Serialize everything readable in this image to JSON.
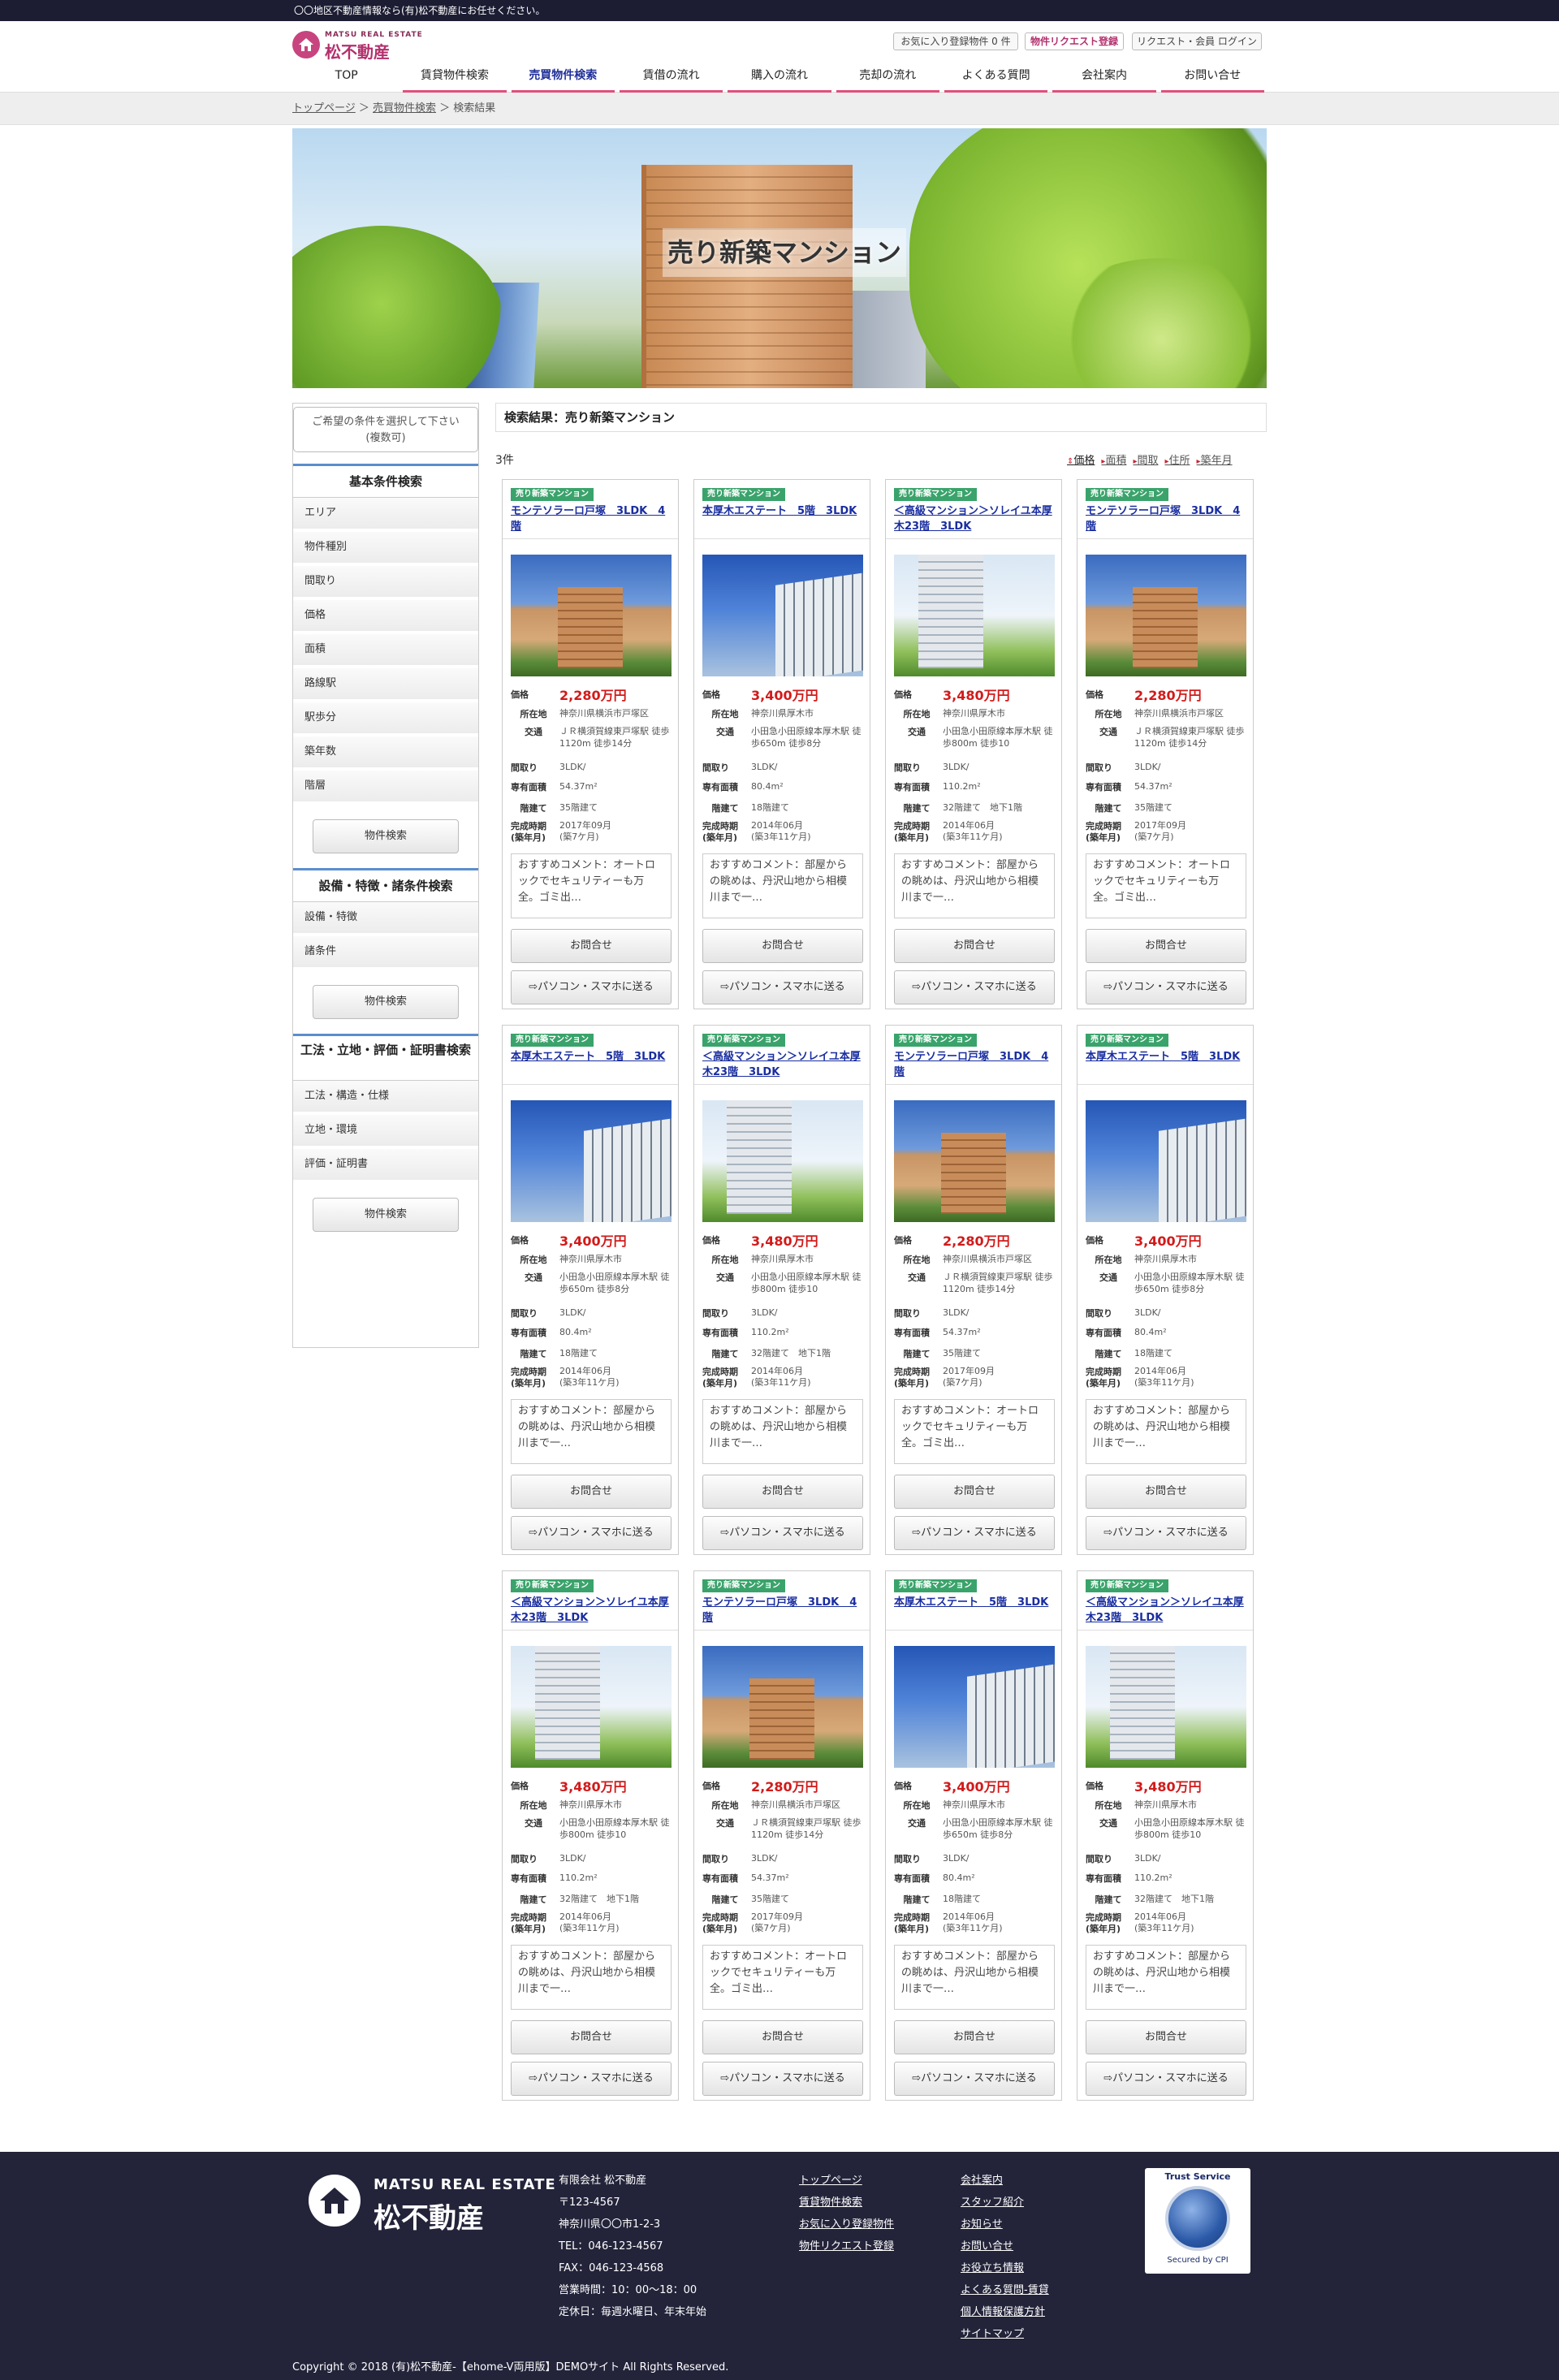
{
  "topbar": {
    "text": "〇〇地区不動産情報なら(有)松不動産にお任せください。"
  },
  "header": {
    "brand_en": "MATSU REAL ESTATE",
    "brand_jp": "松不動産",
    "favorite_text": "お気に入り登録物件 0 件",
    "request_label": "物件リクエスト登録",
    "login_label": "リクエスト・会員 ログイン",
    "accent_color": "#e04f7b"
  },
  "nav": [
    {
      "label": "TOP",
      "underline": false,
      "active": false
    },
    {
      "label": "賃貸物件検索",
      "underline": true,
      "active": false
    },
    {
      "label": "売買物件検索",
      "underline": true,
      "active": true
    },
    {
      "label": "賃借の流れ",
      "underline": true,
      "active": false
    },
    {
      "label": "購入の流れ",
      "underline": true,
      "active": false
    },
    {
      "label": "売却の流れ",
      "underline": true,
      "active": false
    },
    {
      "label": "よくある質問",
      "underline": true,
      "active": false
    },
    {
      "label": "会社案内",
      "underline": true,
      "active": false
    },
    {
      "label": "お問い合せ",
      "underline": true,
      "active": false
    }
  ],
  "breadcrumb": {
    "top": "トップページ",
    "sep": " ＞ ",
    "sale": "売買物件検索",
    "current": "検索結果"
  },
  "hero": {
    "title": "売り新築マンション"
  },
  "sidebar": {
    "note": "ご希望の条件を選択して下さい\n(複数可)",
    "sections": [
      {
        "title": "基本条件検索",
        "items": [
          "エリア",
          "物件種別",
          "間取り",
          "価格",
          "面積",
          "路線駅",
          "駅歩分",
          "築年数",
          "階層"
        ],
        "button": "物件検索"
      },
      {
        "title": "設備・特徴・諸条件検索",
        "items": [
          "設備・特徴",
          "諸条件"
        ],
        "button": "物件検索"
      },
      {
        "title": "工法・立地・評価・証明書検索",
        "items": [
          "工法・構造・仕様",
          "立地・環境",
          "評価・証明書"
        ],
        "button": "物件検索"
      }
    ]
  },
  "results": {
    "heading": "検索結果：売り新築マンション",
    "count": "3件",
    "sort": [
      "価格",
      "面積",
      "間取",
      "住所",
      "築年月"
    ],
    "labels": {
      "price": "価格",
      "address": "所在地",
      "access": "交通",
      "layout": "間取り",
      "area": "専有面積",
      "floors": "階建て",
      "built": "完成時期",
      "built_sub": "(築年月)",
      "contact": "お問合せ",
      "send": "⇨パソコン・スマホに送る"
    }
  },
  "properties": {
    "a": {
      "tag": "売り新築マンション",
      "title": "モンテソラーロ戸塚　3LDK　4階",
      "price": "2,280万円",
      "address": "神奈川県横浜市戸塚区",
      "access": "ＪＲ横須賀線東戸塚駅 徒歩1120m 徒歩14分",
      "layout": "3LDK/",
      "area": "54.37m²",
      "floors": "35階建て",
      "built": "2017年09月",
      "built_sub": "(築7ケ月)",
      "comment": "おすすめコメント：オートロックでセキュリティーも万全。ゴミ出…",
      "photo": "p1"
    },
    "b": {
      "tag": "売り新築マンション",
      "title": "本厚木エステート　5階　3LDK",
      "price": "3,400万円",
      "address": "神奈川県厚木市",
      "access": "小田急小田原線本厚木駅 徒歩650m 徒歩8分",
      "layout": "3LDK/",
      "area": "80.4m²",
      "floors": "18階建て",
      "built": "2014年06月",
      "built_sub": "(築3年11ケ月)",
      "comment": "おすすめコメント：部屋からの眺めは、丹沢山地から相模川まで一…",
      "photo": "p2"
    },
    "c": {
      "tag": "売り新築マンション",
      "title": "＜高級マンション＞ソレイユ本厚木23階　3LDK",
      "price": "3,480万円",
      "address": "神奈川県厚木市",
      "access": "小田急小田原線本厚木駅 徒歩800m 徒歩10",
      "layout": "3LDK/",
      "area": "110.2m²",
      "floors": "32階建て　地下1階",
      "built": "2014年06月",
      "built_sub": "(築3年11ケ月)",
      "comment": "おすすめコメント：部屋からの眺めは、丹沢山地から相模川まで一…",
      "photo": "p3"
    }
  },
  "grid_order": [
    "a",
    "b",
    "c",
    "a",
    "b",
    "c",
    "a",
    "b",
    "c",
    "a",
    "b",
    "c"
  ],
  "footer": {
    "brand_en": "MATSU REAL ESTATE",
    "brand_jp": "松不動産",
    "company": [
      "有限会社 松不動産",
      "〒123-4567",
      "神奈川県〇〇市1-2-3",
      "TEL：046-123-4567",
      "FAX：046-123-4568",
      "営業時間：10：00～18：00",
      "定休日：毎週水曜日、年末年始"
    ],
    "links1": [
      "トップページ",
      "賃貸物件検索",
      "お気に入り登録物件",
      "物件リクエスト登録"
    ],
    "links2": [
      "会社案内",
      "スタッフ紹介",
      "お知らせ",
      "お問い合せ",
      "お役立ち情報",
      "よくある質問-賃貸",
      "個人情報保護方針",
      "サイトマップ"
    ],
    "badge_top": "Trust Service",
    "badge_bottom": "Secured by CPI",
    "copyright": "Copyright © 2018 (有)松不動産-【ehome-V両用版】DEMOサイト All Rights Reserved."
  }
}
